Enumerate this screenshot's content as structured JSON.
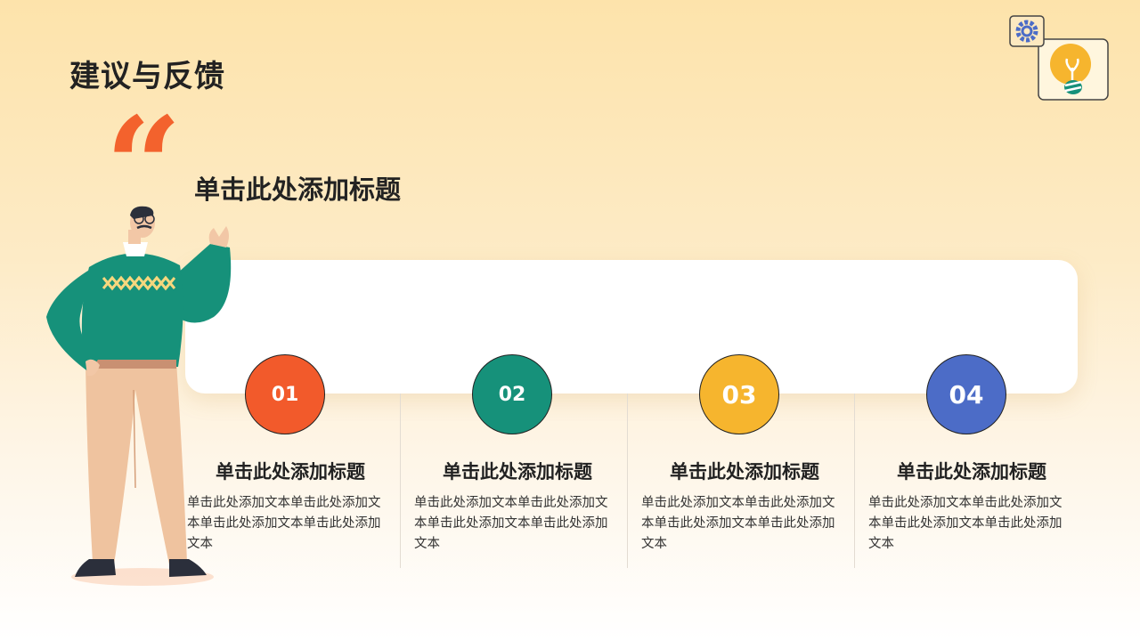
{
  "page": {
    "title": "建议与反馈",
    "quote_mark": "“",
    "subtitle": "单击此处添加标题"
  },
  "cards": [
    {
      "number": "01",
      "color": "#f25a2b",
      "title": "单击此处添加标题",
      "text": "单击此处添加文本单击此处添加文本单击此处添加文本单击此处添加文本"
    },
    {
      "number": "02",
      "color": "#16917a",
      "title": "单击此处添加标题",
      "text": "单击此处添加文本单击此处添加文本单击此处添加文本单击此处添加文本"
    },
    {
      "number": "03",
      "color": "#f6b52e",
      "title": "单击此处添加标题",
      "text": "单击此处添加文本单击此处添加文本单击此处添加文本单击此处添加文本"
    },
    {
      "number": "04",
      "color": "#4c6cc7",
      "title": "单击此处添加标题",
      "text": "单击此处添加文本单击此处添加文本单击此处添加文本单击此处添加文本"
    }
  ],
  "icons": {
    "gear": "gear-icon",
    "lightbulb": "lightbulb-icon",
    "presenter": "presenter-illustration"
  },
  "colors": {
    "accent": "#f3622d",
    "green": "#16917a",
    "yellow": "#f6b52e",
    "blue": "#4c6cc7"
  }
}
